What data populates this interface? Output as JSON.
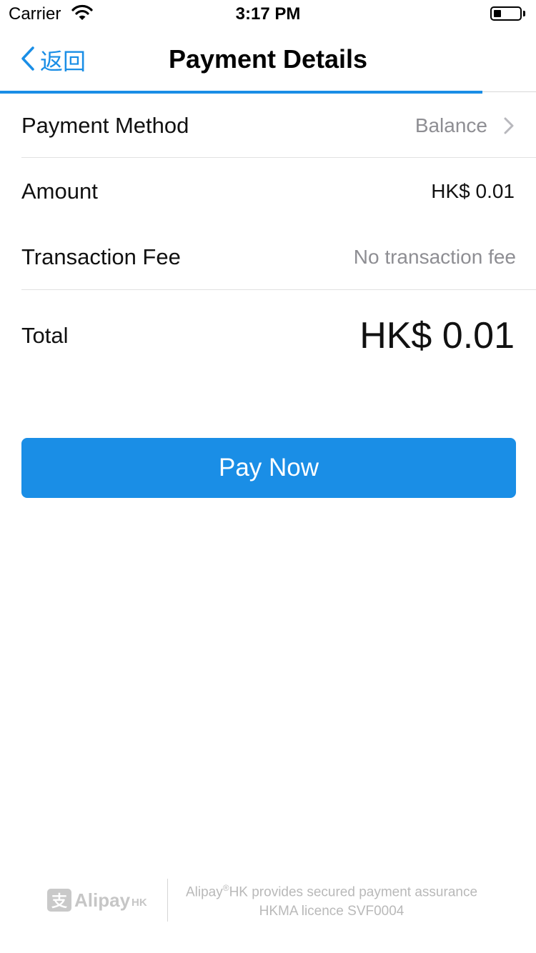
{
  "status_bar": {
    "carrier": "Carrier",
    "time": "3:17 PM",
    "battery_level_fraction": 0.3
  },
  "nav": {
    "back_label": "返回",
    "title": "Payment Details",
    "progress_fraction": 0.9
  },
  "details": {
    "payment_method_label": "Payment Method",
    "payment_method_value": "Balance",
    "amount_label": "Amount",
    "amount_value": "HK$ 0.01",
    "fee_label": "Transaction Fee",
    "fee_value": "No transaction fee",
    "total_label": "Total",
    "total_value": "HK$ 0.01"
  },
  "actions": {
    "pay_label": "Pay Now"
  },
  "footer": {
    "logo_mark": "支",
    "logo_text": "Alipay",
    "logo_suffix": "HK",
    "assurance_brand": "Alipay",
    "assurance_reg": "®",
    "assurance_rest": "HK provides secured payment assurance",
    "licence": "HKMA licence SVF0004"
  },
  "colors": {
    "accent": "#1a8ee6",
    "muted_text": "#8e8e93",
    "footer_text": "#b9b9b9"
  },
  "icons": [
    "wifi-icon",
    "battery-icon",
    "chevron-left-icon",
    "chevron-right-icon"
  ]
}
